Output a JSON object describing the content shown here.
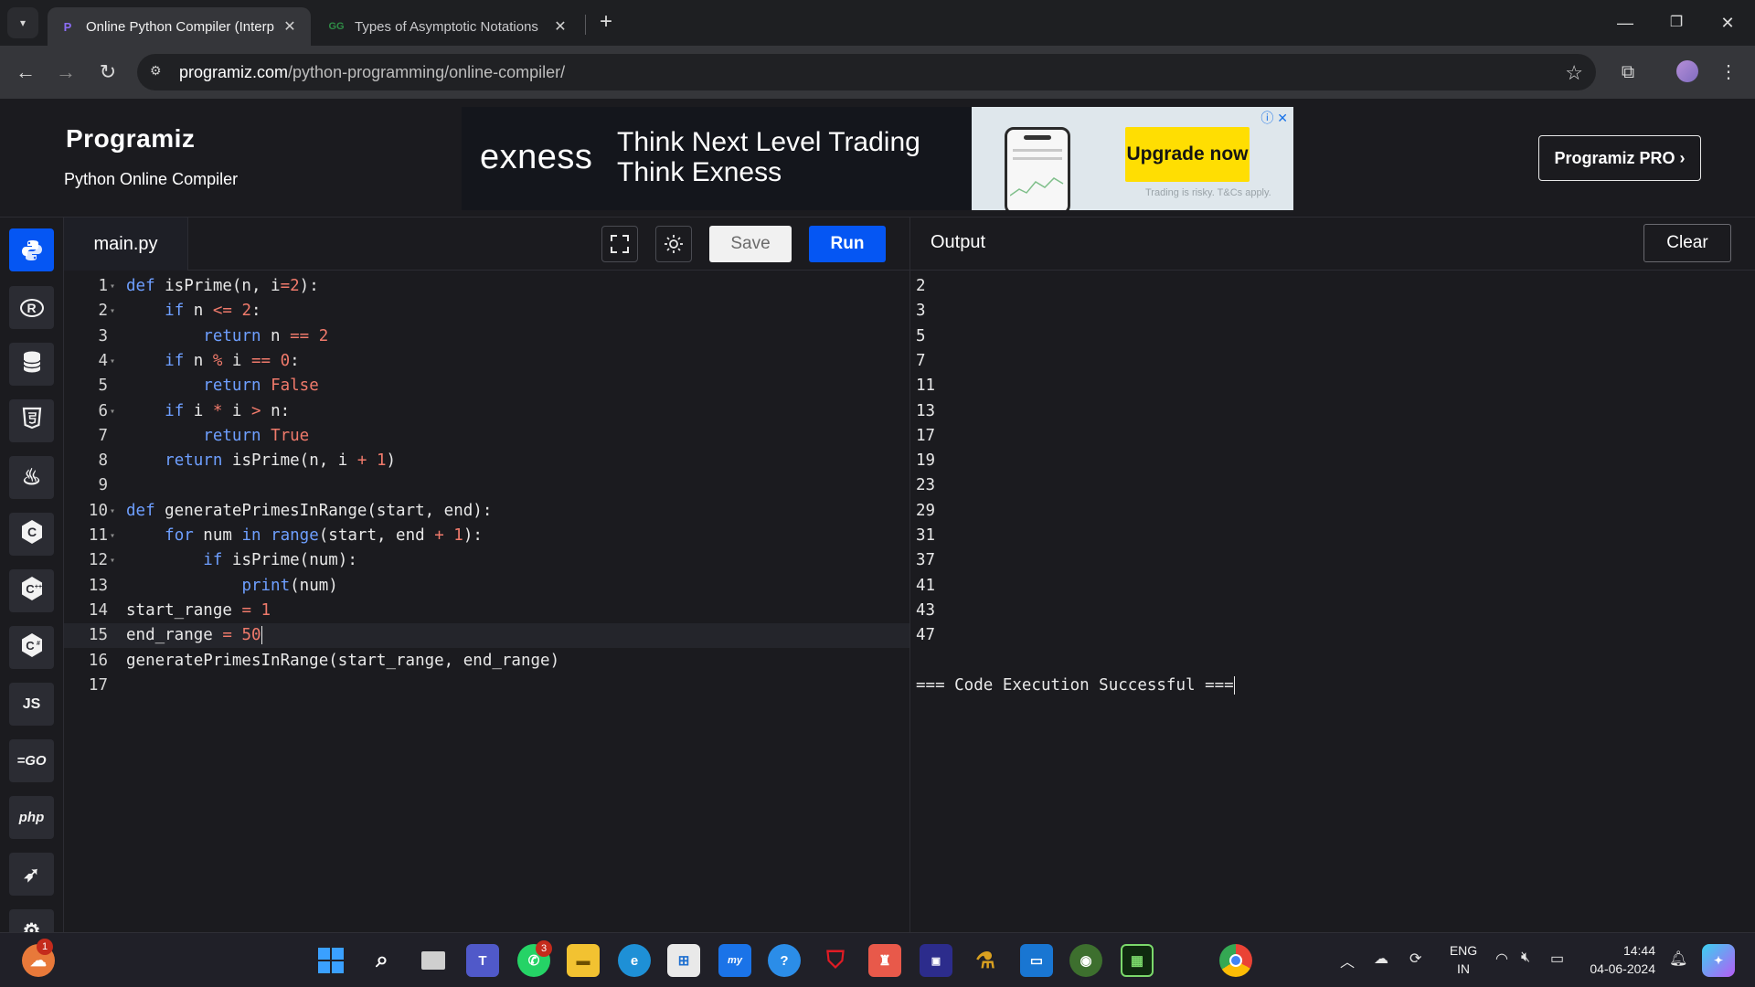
{
  "browser": {
    "tabs": [
      {
        "title": "Online Python Compiler (Interp",
        "active": true
      },
      {
        "title": "Types of Asymptotic Notations",
        "active": false
      }
    ],
    "url_host": "programiz.com",
    "url_path": "/python-programming/online-compiler/",
    "window_controls": {
      "minimize": "—",
      "restore": "❐",
      "close": "✕"
    }
  },
  "header": {
    "logo": "Programiz",
    "subtitle": "Python Online Compiler",
    "pro_button": "Programiz PRO ›"
  },
  "ad": {
    "brand": "exness",
    "line1": "Think Next Level Trading",
    "line2": "Think Exness",
    "cta": "Upgrade now",
    "fine_print": "Trading is risky. T&Cs apply."
  },
  "rail": {
    "items": [
      {
        "name": "python",
        "label": "🐍",
        "active": true
      },
      {
        "name": "r",
        "label": "R"
      },
      {
        "name": "sql",
        "label": "≡"
      },
      {
        "name": "html",
        "label": "5"
      },
      {
        "name": "java",
        "label": "♨"
      },
      {
        "name": "c",
        "label": "C"
      },
      {
        "name": "cpp",
        "label": "C"
      },
      {
        "name": "csharp",
        "label": "C"
      },
      {
        "name": "js",
        "label": "JS"
      },
      {
        "name": "go",
        "label": "GO"
      },
      {
        "name": "php",
        "label": "php"
      },
      {
        "name": "swift",
        "label": "➶"
      },
      {
        "name": "rust",
        "label": "R"
      }
    ]
  },
  "editor": {
    "file_tab": "main.py",
    "save_label": "Save",
    "run_label": "Run",
    "lines": [
      {
        "n": "1",
        "fold": true
      },
      {
        "n": "2",
        "fold": true
      },
      {
        "n": "3",
        "fold": false
      },
      {
        "n": "4",
        "fold": true
      },
      {
        "n": "5",
        "fold": false
      },
      {
        "n": "6",
        "fold": true
      },
      {
        "n": "7",
        "fold": false
      },
      {
        "n": "8",
        "fold": false
      },
      {
        "n": "9",
        "fold": false
      },
      {
        "n": "10",
        "fold": true
      },
      {
        "n": "11",
        "fold": true
      },
      {
        "n": "12",
        "fold": true
      },
      {
        "n": "13",
        "fold": false
      },
      {
        "n": "14",
        "fold": false
      },
      {
        "n": "15",
        "fold": false
      },
      {
        "n": "16",
        "fold": false
      },
      {
        "n": "17",
        "fold": false
      }
    ],
    "code": [
      "def isPrime(n, i=2):",
      "    if n <= 2:",
      "        return n == 2",
      "    if n % i == 0:",
      "        return False",
      "    if i * i > n:",
      "        return True",
      "    return isPrime(n, i + 1)",
      "",
      "def generatePrimesInRange(start, end):",
      "    for num in range(start, end + 1):",
      "        if isPrime(num):",
      "            print(num)",
      "start_range = 1",
      "end_range = 50",
      "generatePrimesInRange(start_range, end_range)",
      ""
    ],
    "current_line": 15
  },
  "output": {
    "title": "Output",
    "clear_label": "Clear",
    "lines": [
      "2",
      "3",
      "5",
      "7",
      "11",
      "13",
      "17",
      "19",
      "23",
      "29",
      "31",
      "37",
      "41",
      "43",
      "47",
      "",
      "=== Code Execution Successful ==="
    ]
  },
  "taskbar": {
    "notification_badge": "1",
    "whatsapp_badge": "3",
    "lang_line1": "ENG",
    "lang_line2": "IN",
    "time": "14:44",
    "date": "04-06-2024"
  }
}
